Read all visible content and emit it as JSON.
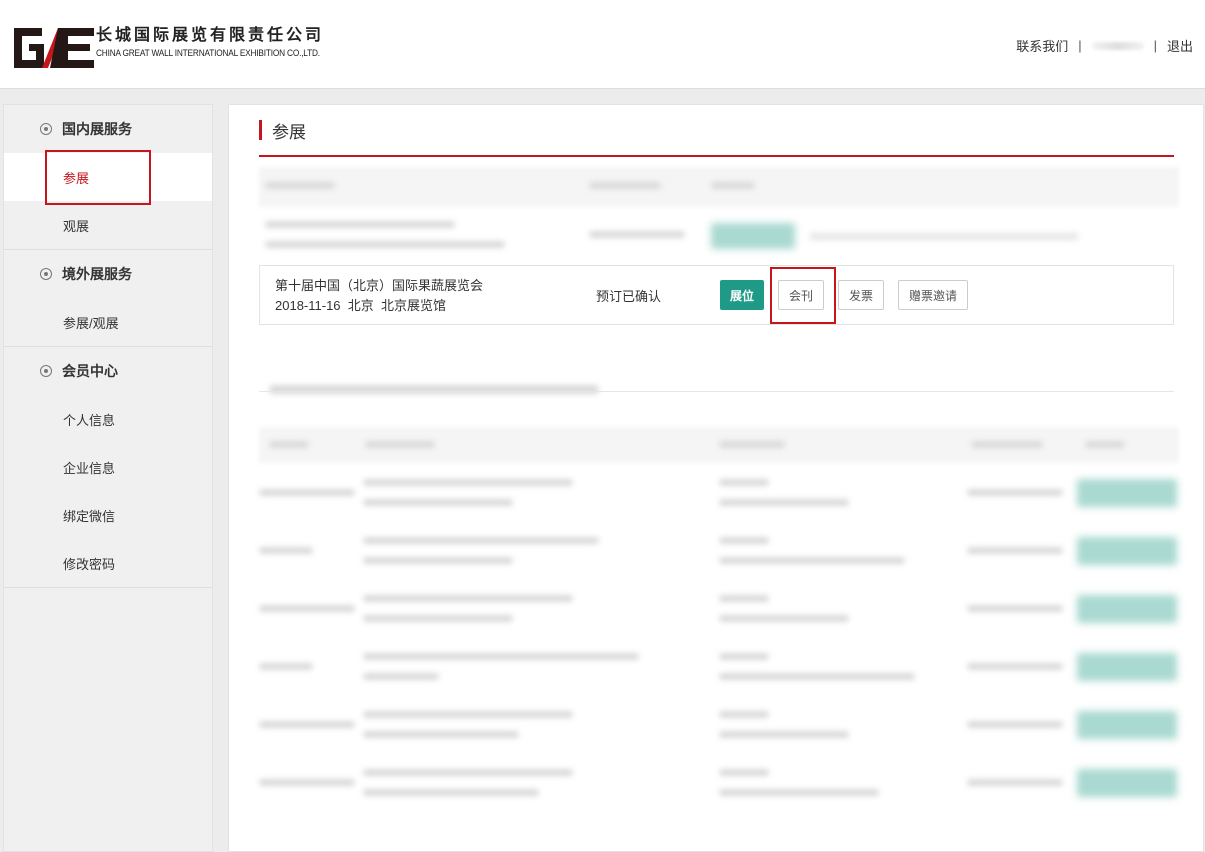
{
  "header": {
    "logo_cn": "长城国际展览有限责任公司",
    "logo_en": "CHINA GREAT WALL INTERNATIONAL EXHIBITION CO.,LTD.",
    "contact_label": "联系我们",
    "separator": "|",
    "logout_label": "退出"
  },
  "sidebar": {
    "groups": [
      {
        "title": "国内展服务",
        "items": [
          {
            "label": "参展"
          },
          {
            "label": "观展"
          }
        ]
      },
      {
        "title": "境外展服务",
        "items": [
          {
            "label": "参展/观展"
          }
        ]
      },
      {
        "title": "会员中心",
        "items": [
          {
            "label": "个人信息"
          },
          {
            "label": "企业信息"
          },
          {
            "label": "绑定微信"
          },
          {
            "label": "修改密码"
          }
        ]
      }
    ],
    "active_item": "参展"
  },
  "main": {
    "title": "参展",
    "row": {
      "name": "第十届中国（北京）国际果蔬展览会",
      "detail": "2018-11-16  北京  北京展览馆",
      "status": "预订已确认",
      "buttons": {
        "booth": "展位",
        "catalog": "会刊",
        "invoice": "发票",
        "invite": "赠票邀请"
      }
    }
  },
  "colors": {
    "accent": "#c4161c",
    "teal": "#1e9a86"
  },
  "icons": {
    "group_bullet": "circle-dot-icon",
    "logo": "ge-logo-icon"
  }
}
